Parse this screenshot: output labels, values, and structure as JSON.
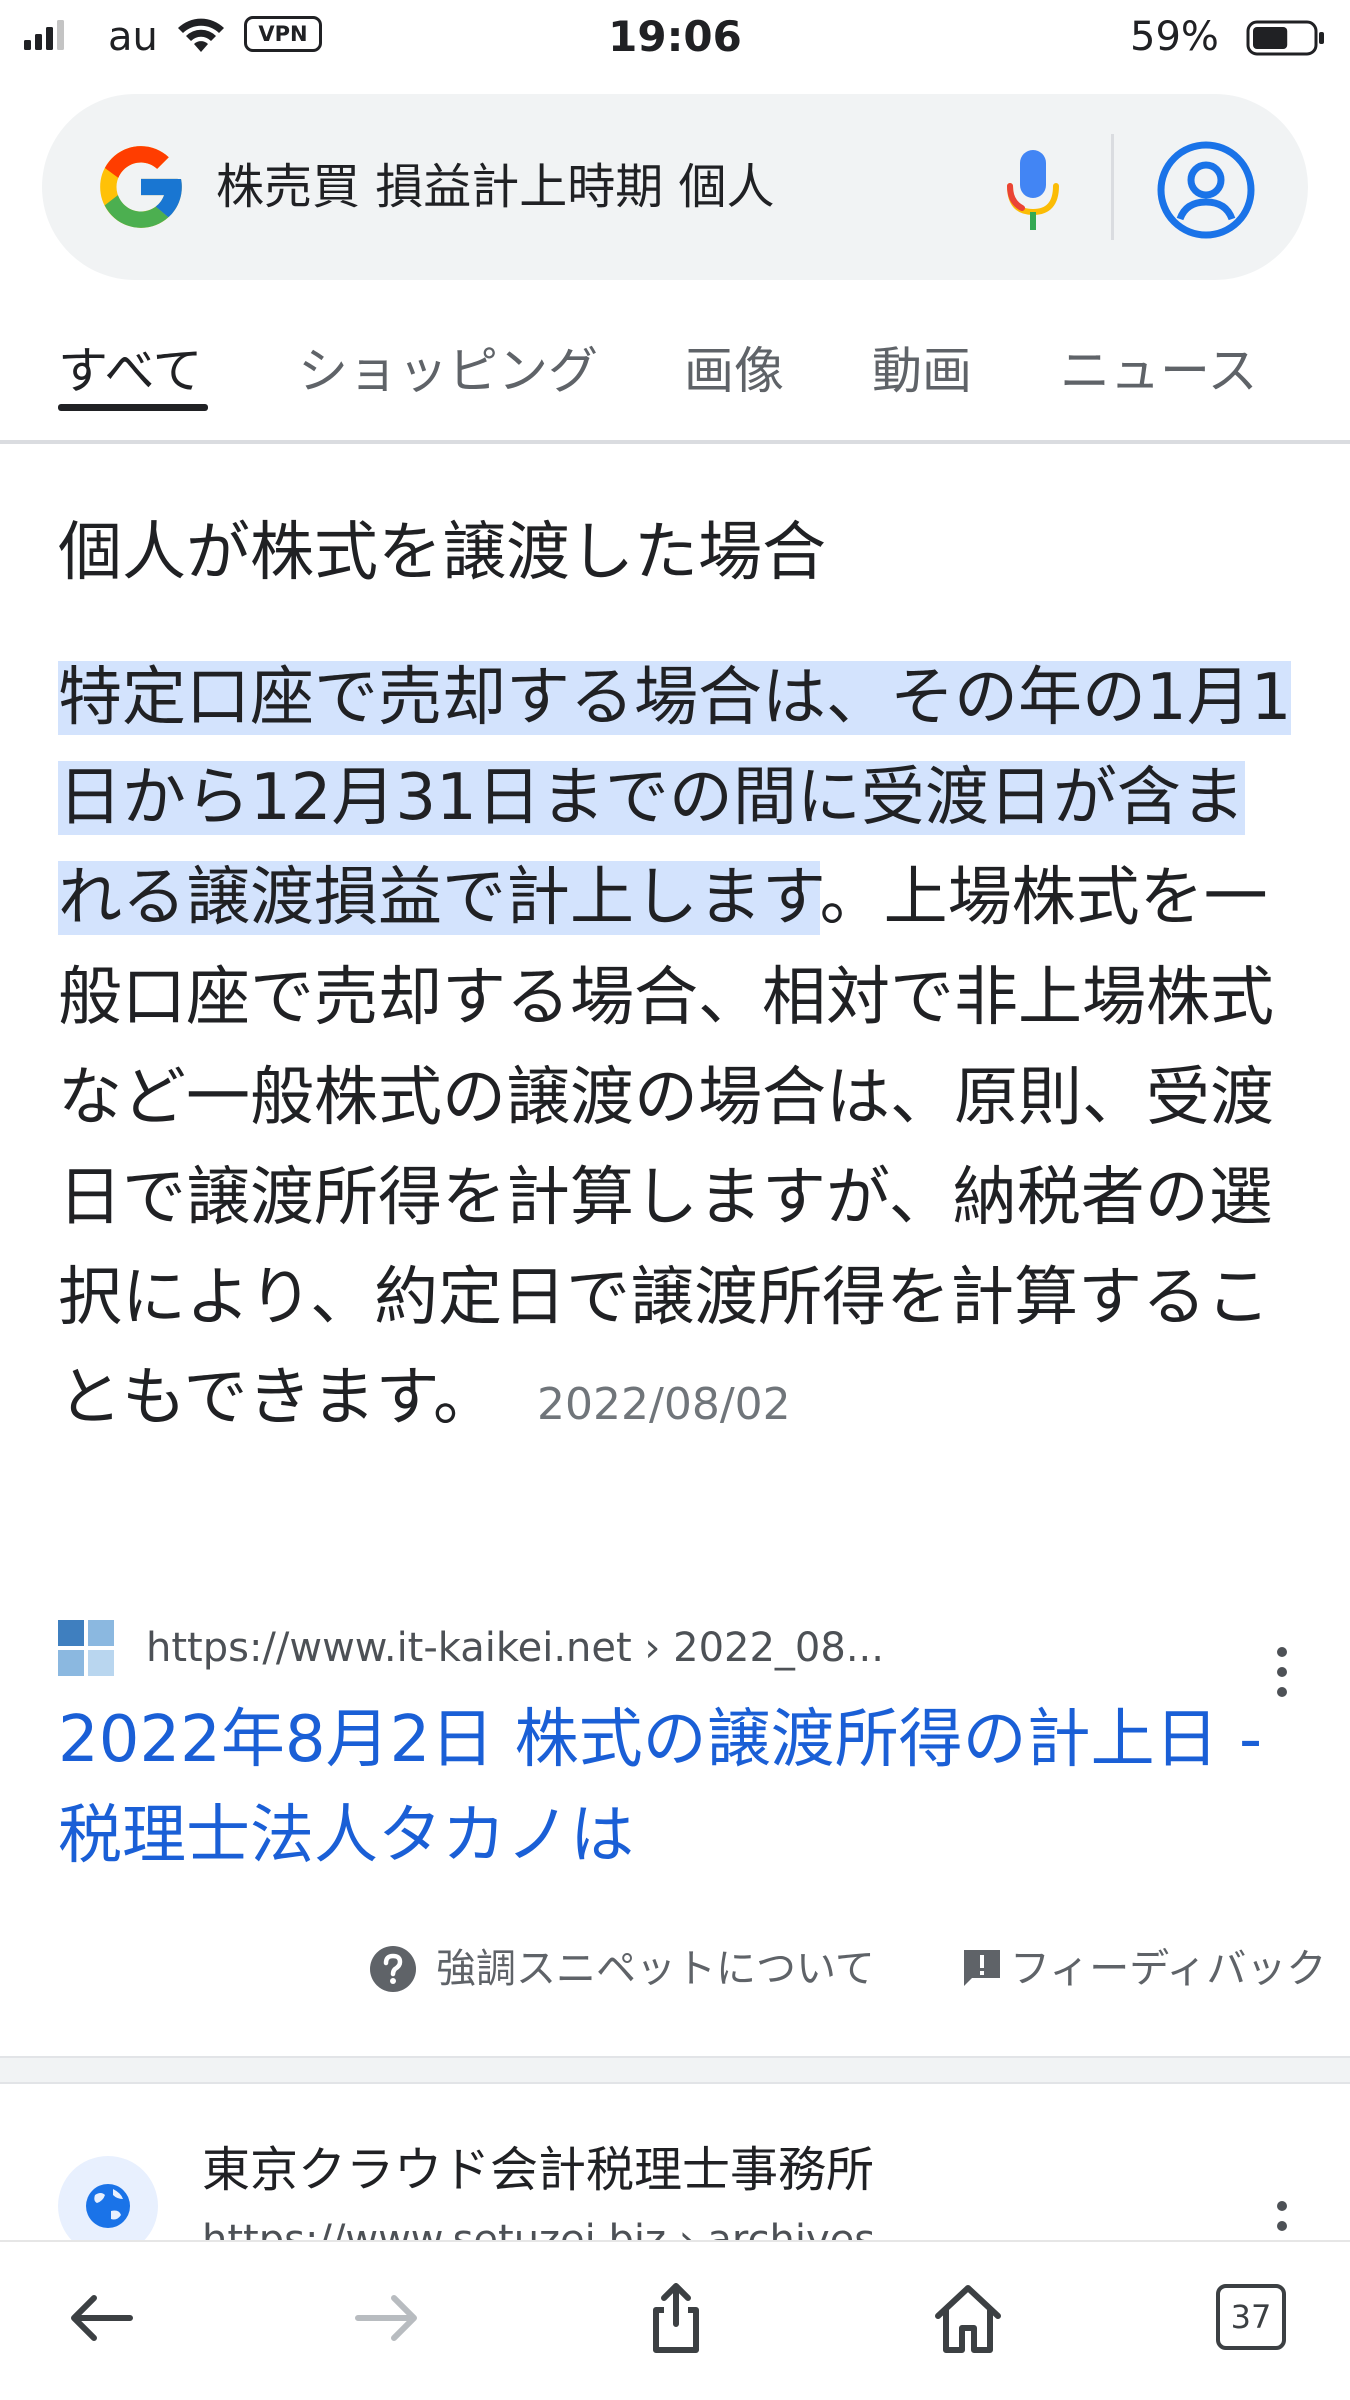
{
  "status_bar": {
    "carrier": "au",
    "vpn_label": "VPN",
    "time": "19:06",
    "battery_percent": "59%",
    "battery_level": 0.59
  },
  "search": {
    "query": "株売買 損益計上時期 個人"
  },
  "tabs": [
    {
      "label": "すべて",
      "active": true
    },
    {
      "label": "ショッピング",
      "active": false
    },
    {
      "label": "画像",
      "active": false
    },
    {
      "label": "動画",
      "active": false
    },
    {
      "label": "ニュース",
      "active": false
    }
  ],
  "snippet": {
    "heading": "個人が株式を譲渡した場合",
    "highlighted_text": "特定口座で売却する場合は、その年の1月1日から12月31日までの間に受渡日が含まれる譲渡損益で計上します",
    "body_text": "。上場株式を一般口座で売却する場合、相対で非上場株式など一般株式の譲渡の場合は、原則、受渡日で譲渡所得を計算しますが、納税者の選択により、約定日で譲渡所得を計算することもできます。",
    "date": "2022/08/02",
    "source_url": "https://www.it-kaikei.net › 2022_08...",
    "result_title": "2022年8月2日 株式の譲渡所得の計上日 - 税理士法人タカノは",
    "about_label": "強調スニペットについて",
    "feedback_label": "フィーディバック"
  },
  "second_result": {
    "site_name": "東京クラウド会計税理士事務所",
    "url": "https://www.setuzei.biz › archives"
  },
  "toolbar": {
    "tab_count": "37"
  },
  "colors": {
    "link": "#1a5fd6",
    "highlight": "#d3e3fd",
    "accent_blue": "#1a73e8"
  }
}
